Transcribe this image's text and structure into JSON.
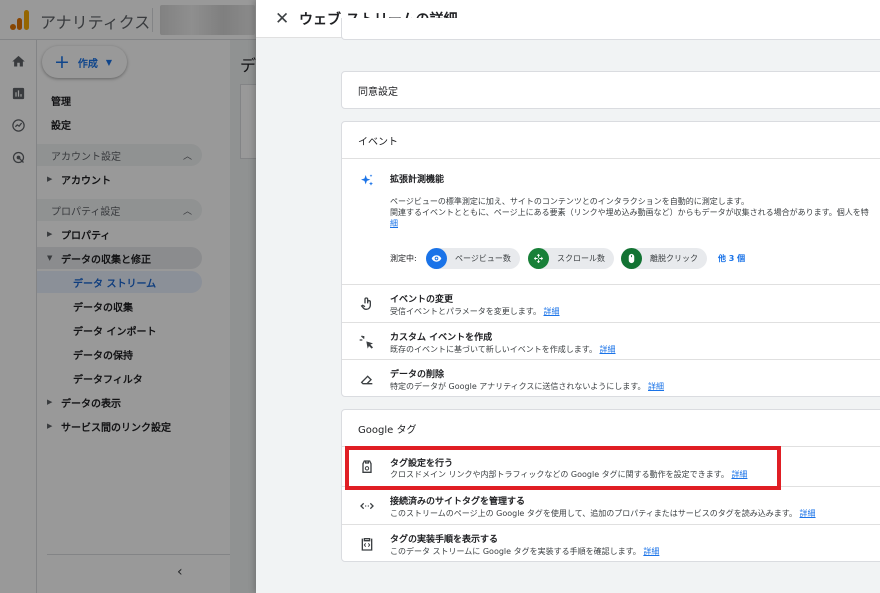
{
  "app": {
    "title": "アナリティクス"
  },
  "nav": {
    "create_label": "作成",
    "admin": "管理",
    "settings": "設定",
    "account_section": "アカウント設定",
    "account": "アカウント",
    "property_section": "プロパティ設定",
    "property": "プロパティ",
    "data_collection_group": "データの収集と修正",
    "data_streams": "データ ストリーム",
    "data_collection": "データの収集",
    "data_import": "データ インポート",
    "data_retention": "データの保持",
    "data_filters": "データフィルタ",
    "data_display": "データの表示",
    "product_links": "サービス間のリンク設定"
  },
  "main": {
    "title": "デ"
  },
  "panel": {
    "title": "ウェブ ストリームの詳細",
    "consent_title": "同意設定",
    "events": {
      "title": "イベント",
      "enhanced_title": "拡張計測機能",
      "enhanced_desc1": "ページビューの標準測定に加え、サイトのコンテンツとのインタラクションを自動的に測定します。",
      "enhanced_desc2": "関連するイベントとともに、ページ上にある要素（リンクや埋め込み動画など）からもデータが収集される場合があります。個人を特",
      "enhanced_link": "細",
      "measuring_label": "測定中:",
      "chips": [
        "ページビュー数",
        "スクロール数",
        "離脱クリック"
      ],
      "more": "他 3 個",
      "modify_title": "イベントの変更",
      "modify_desc": "受信イベントとパラメータを変更します。",
      "create_title": "カスタム イベントを作成",
      "create_desc": "既存のイベントに基づいて新しいイベントを作成します。",
      "delete_title": "データの削除",
      "delete_desc": "特定のデータが Google アナリティクスに送信されないようにします。"
    },
    "google_tag": {
      "title": "Google タグ",
      "configure_title": "タグ設定を行う",
      "configure_desc": "クロスドメイン リンクや内部トラフィックなどの Google タグに関する動作を設定できます。",
      "manage_title": "接続済みのサイトタグを管理する",
      "manage_desc": "このストリームのページ上の Google タグを使用して、追加のプロパティまたはサービスのタグを読み込みます。",
      "install_title": "タグの実装手順を表示する",
      "install_desc": "このデータ ストリームに Google タグを実装する手順を確認します。"
    },
    "details_link": "詳細"
  },
  "colors": {
    "accent": "#1a73e8",
    "highlight": "#e01e24",
    "chip_blue": "#1a73e8",
    "chip_green": "#188038",
    "chip_teal": "#137333"
  }
}
